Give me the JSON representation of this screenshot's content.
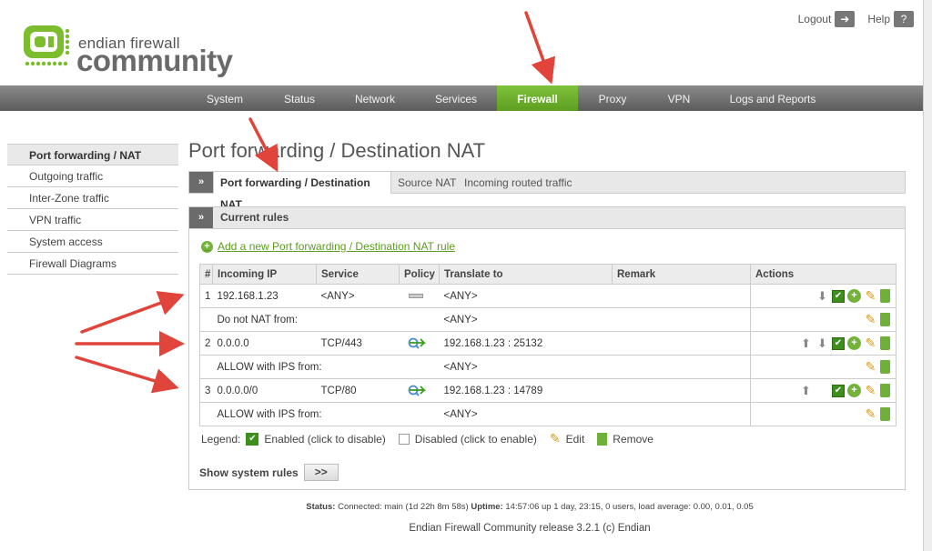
{
  "header": {
    "logo_line1": "endian firewall",
    "logo_line2": "community",
    "logout": "Logout",
    "help": "Help"
  },
  "nav": {
    "items": [
      "System",
      "Status",
      "Network",
      "Services",
      "Firewall",
      "Proxy",
      "VPN",
      "Logs and Reports"
    ],
    "active": "Firewall"
  },
  "sidebar": {
    "items": [
      "Port forwarding / NAT",
      "Outgoing traffic",
      "Inter-Zone traffic",
      "VPN traffic",
      "System access",
      "Firewall Diagrams"
    ]
  },
  "page_title": "Port forwarding / Destination NAT",
  "tabs": [
    "Port forwarding / Destination NAT",
    "Source NAT",
    "Incoming routed traffic"
  ],
  "tab_toggle": "»",
  "panel": {
    "title": "Current rules",
    "add_link": "Add a new Port forwarding / Destination NAT rule"
  },
  "table": {
    "headers": [
      "#",
      "Incoming IP",
      "Service",
      "Policy",
      "Translate to",
      "Remark",
      "Actions"
    ],
    "rules": [
      {
        "num": "1",
        "ip": "192.168.1.23",
        "service": "<ANY>",
        "translate": "<ANY>",
        "sub_label": "Do not NAT from:",
        "sub_value": "<ANY>"
      },
      {
        "num": "2",
        "ip": "0.0.0.0",
        "service": "TCP/443",
        "translate": "192.168.1.23 : 25132",
        "sub_label": "ALLOW with IPS from:",
        "sub_value": "<ANY>"
      },
      {
        "num": "3",
        "ip": "0.0.0.0/0",
        "service": "TCP/80",
        "translate": "192.168.1.23 : 14789",
        "sub_label": "ALLOW with IPS from:",
        "sub_value": "<ANY>"
      }
    ]
  },
  "legend": {
    "label": "Legend:",
    "enabled": "Enabled (click to disable)",
    "disabled": "Disabled (click to enable)",
    "edit": "Edit",
    "remove": "Remove"
  },
  "show_system": {
    "label": "Show system rules",
    "button": ">>"
  },
  "footer": {
    "status_label": "Status:",
    "status_value": "Connected: main (1d 22h 8m 58s)",
    "uptime_label": "Uptime:",
    "uptime_value": "14:57:06 up 1 day, 23:15, 0 users, load average: 0.00, 0.01, 0.05",
    "release": "Endian Firewall Community release 3.2.1 (c) Endian"
  },
  "colors": {
    "accent": "#6bb02a",
    "annotation_arrow": "#e0443a",
    "nav_bg": "#6f6f6f"
  }
}
